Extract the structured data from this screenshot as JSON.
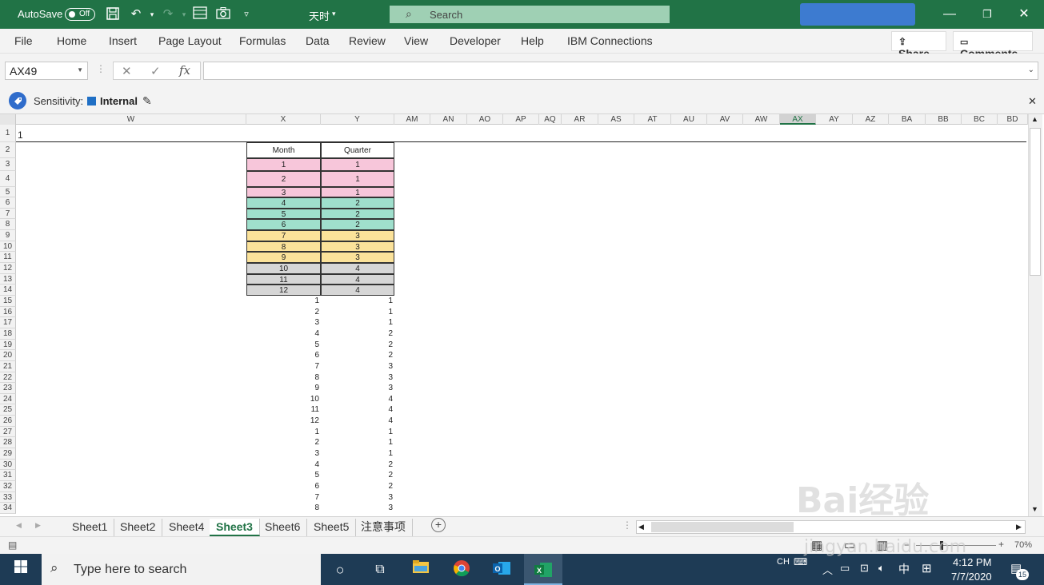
{
  "titlebar": {
    "autosave_label": "AutoSave",
    "autosave_state": "Off",
    "file_name": "天时",
    "search_placeholder": "Search"
  },
  "ribbon": {
    "tabs": [
      "File",
      "Home",
      "Insert",
      "Page Layout",
      "Formulas",
      "Data",
      "Review",
      "View",
      "Developer",
      "Help",
      "IBM Connections"
    ],
    "share_label": "Share",
    "comments_label": "Comments"
  },
  "formula_bar": {
    "name_box": "AX49",
    "fx_label": "fx",
    "formula": ""
  },
  "sensitivity": {
    "label": "Sensitivity:",
    "value": "Internal",
    "value_color": "#1f6fc5"
  },
  "grid": {
    "columns": [
      "W",
      "X",
      "Y",
      "AM",
      "AN",
      "AO",
      "AP",
      "AQ",
      "AR",
      "AS",
      "AT",
      "AU",
      "AV",
      "AW",
      "AX",
      "AY",
      "AZ",
      "BA",
      "BB",
      "BC",
      "BD"
    ],
    "selected_column": "AX",
    "row_numbers": [
      "1",
      "2",
      "3",
      "4",
      "5",
      "6",
      "7",
      "8",
      "9",
      "10",
      "11",
      "12",
      "13",
      "14",
      "15",
      "16",
      "17",
      "18",
      "19",
      "20",
      "21",
      "22",
      "23",
      "24",
      "25",
      "26",
      "27",
      "28",
      "29",
      "30",
      "31",
      "32",
      "33",
      "34"
    ],
    "row1_value": "1",
    "table_headers": [
      "Month",
      "Quarter"
    ],
    "table_rows": [
      {
        "month": "1",
        "quarter": "1",
        "color": "#f7c6da"
      },
      {
        "month": "2",
        "quarter": "1",
        "color": "#f7c6da"
      },
      {
        "month": "3",
        "quarter": "1",
        "color": "#f7c6da"
      },
      {
        "month": "4",
        "quarter": "2",
        "color": "#9fdfcc"
      },
      {
        "month": "5",
        "quarter": "2",
        "color": "#9fdfcc"
      },
      {
        "month": "6",
        "quarter": "2",
        "color": "#9fdfcc"
      },
      {
        "month": "7",
        "quarter": "3",
        "color": "#fbe29a"
      },
      {
        "month": "8",
        "quarter": "3",
        "color": "#fbe29a"
      },
      {
        "month": "9",
        "quarter": "3",
        "color": "#fbe29a"
      },
      {
        "month": "10",
        "quarter": "4",
        "color": "#d6d6d6"
      },
      {
        "month": "11",
        "quarter": "4",
        "color": "#d6d6d6"
      },
      {
        "month": "12",
        "quarter": "4",
        "color": "#d6d6d6"
      }
    ],
    "plain_rows": [
      {
        "month": "1",
        "quarter": "1"
      },
      {
        "month": "2",
        "quarter": "1"
      },
      {
        "month": "3",
        "quarter": "1"
      },
      {
        "month": "4",
        "quarter": "2"
      },
      {
        "month": "5",
        "quarter": "2"
      },
      {
        "month": "6",
        "quarter": "2"
      },
      {
        "month": "7",
        "quarter": "3"
      },
      {
        "month": "8",
        "quarter": "3"
      },
      {
        "month": "9",
        "quarter": "3"
      },
      {
        "month": "10",
        "quarter": "4"
      },
      {
        "month": "11",
        "quarter": "4"
      },
      {
        "month": "12",
        "quarter": "4"
      },
      {
        "month": "1",
        "quarter": "1"
      },
      {
        "month": "2",
        "quarter": "1"
      },
      {
        "month": "3",
        "quarter": "1"
      },
      {
        "month": "4",
        "quarter": "2"
      },
      {
        "month": "5",
        "quarter": "2"
      },
      {
        "month": "6",
        "quarter": "2"
      },
      {
        "month": "7",
        "quarter": "3"
      },
      {
        "month": "8",
        "quarter": "3"
      }
    ]
  },
  "sheet_tabs": [
    "Sheet1",
    "Sheet2",
    "Sheet4",
    "Sheet3",
    "Sheet6",
    "Sheet5",
    "注意事项"
  ],
  "active_sheet": "Sheet3",
  "status_bar": {
    "zoom": "70%"
  },
  "taskbar": {
    "search_placeholder": "Type here to search",
    "lang": "CH",
    "ime": "中",
    "time": "4:12 PM",
    "date": "7/7/2020",
    "notifications": "15"
  },
  "watermark": {
    "text": "Bai经验",
    "url": "jingyan.baidu.com"
  },
  "colors": {
    "excel_green": "#217346",
    "taskbar": "#1e3b55"
  }
}
